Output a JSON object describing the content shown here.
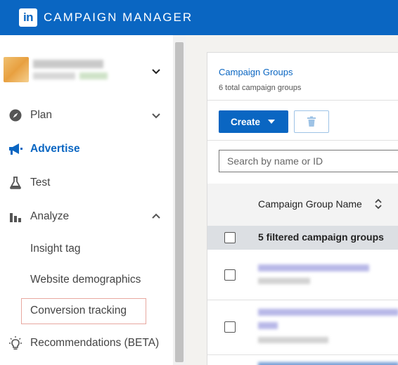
{
  "app": {
    "logo_text": "in",
    "title": "CAMPAIGN MANAGER"
  },
  "sidebar": {
    "nav": [
      {
        "label": "Plan",
        "icon": "compass-icon",
        "expanded": false
      },
      {
        "label": "Advertise",
        "icon": "megaphone-icon",
        "active": true
      },
      {
        "label": "Test",
        "icon": "flask-icon"
      },
      {
        "label": "Analyze",
        "icon": "bar-chart-icon",
        "expanded": true
      }
    ],
    "analyze_items": [
      "Insight tag",
      "Website demographics",
      "Conversion tracking"
    ],
    "recommendations": "Recommendations (BETA)"
  },
  "main": {
    "title": "Campaign Groups",
    "subtitle": "6 total campaign groups",
    "create_label": "Create",
    "search_placeholder": "Search by name or ID",
    "column_header": "Campaign Group Name",
    "filter_label": "5 filtered campaign groups"
  },
  "colors": {
    "brand": "#0a66c2",
    "highlight_border": "#e8a8a0"
  }
}
